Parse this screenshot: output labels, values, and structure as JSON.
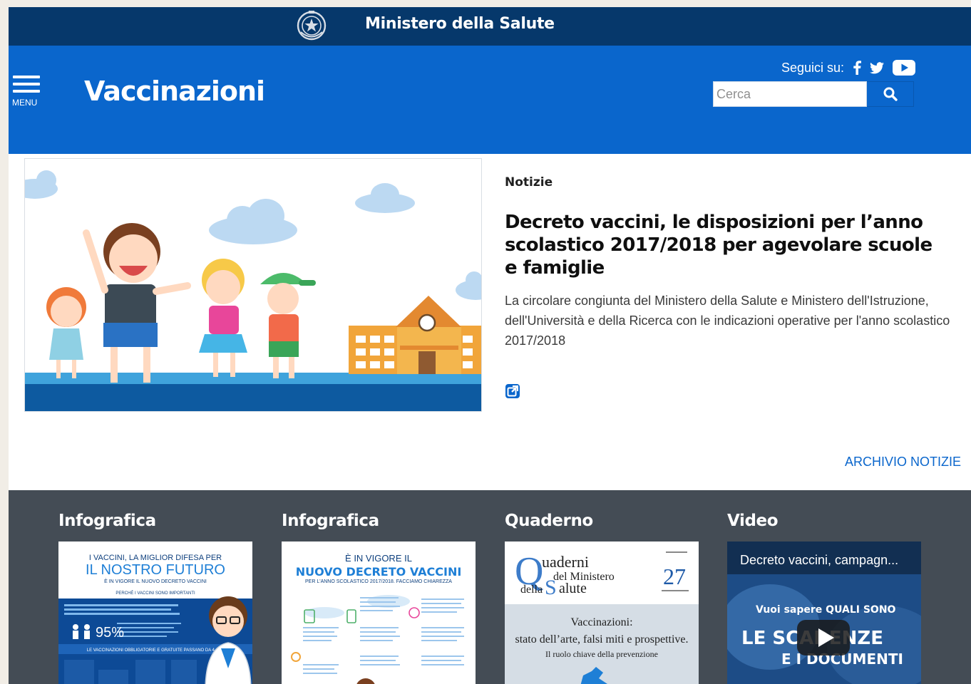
{
  "top_bar": {
    "ministry_name": "Ministero della Salute"
  },
  "header": {
    "menu_label": "MENU",
    "site_title": "Vaccinazioni",
    "follow_label": "Seguici su:",
    "social_icons": [
      "facebook-icon",
      "twitter-icon",
      "youtube-icon"
    ],
    "search_placeholder": "Cerca"
  },
  "news": {
    "category": "Notizie",
    "title": "Decreto vaccini, le disposizioni per l’anno scolastico 2017/2018 per agevolare scuole e famiglie",
    "description": "La circolare congiunta del Ministero della Salute e Ministero dell'Istruzione, dell'Università e della Ricerca con le indicazioni operative per l'anno scolastico 2017/2018",
    "archive_link": "ARCHIVIO NOTIZIE"
  },
  "cards": [
    {
      "type": "Infografica",
      "thumb": {
        "line1": "I VACCINI, LA MIGLIOR DIFESA PER",
        "line2": "IL NOSTRO FUTURO",
        "line3": "È IN VIGORE IL NUOVO DECRETO VACCINI",
        "band1": "PERCHÉ I VACCINI SONO IMPORTANTI",
        "stat": "95%",
        "band2": "LE VACCINAZIONI OBBLIGATORIE E GRATUITE PASSANO DA 4 A 10"
      }
    },
    {
      "type": "Infografica",
      "thumb": {
        "line1": "È IN VIGORE IL",
        "line2": "NUOVO DECRETO VACCINI",
        "line3": "PER L'ANNO SCOLASTICO 2017/2018. FACCIAMO CHIAREZZA"
      }
    },
    {
      "type": "Quaderno",
      "thumb": {
        "q_word": "uaderni",
        "q_line2": "del Ministero",
        "q_line3": "della",
        "q_line3b": "alute",
        "issue": "27",
        "title1": "Vaccinazioni:",
        "title2": "stato dell’arte, falsi miti e prospettive.",
        "title3": "Il ruolo chiave della prevenzione"
      }
    },
    {
      "type": "Video",
      "thumb": {
        "video_title": "Decreto vaccini, campagn...",
        "line1": "Vuoi sapere QUALI SONO",
        "line2": "LE SCADENZE",
        "line3": "E I DOCUMENTI"
      }
    }
  ],
  "colors": {
    "top_bar": "#06386b",
    "header": "#0a66cc",
    "dark_section": "#444c55",
    "link": "#0a66cc"
  }
}
